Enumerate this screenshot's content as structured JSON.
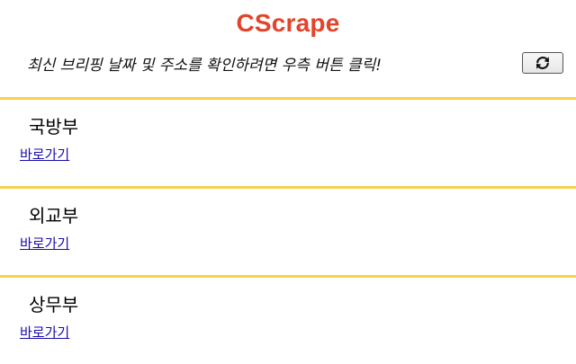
{
  "app": {
    "title": "CScrape",
    "instruction": "최신 브리핑 날짜 및 주소를 확인하려면 우측 버튼 클릭!",
    "refresh_icon": "refresh-icon"
  },
  "sections": [
    {
      "title": "국방부",
      "link_label": "바로가기"
    },
    {
      "title": "외교부",
      "link_label": "바로가기"
    },
    {
      "title": "상무부",
      "link_label": "바로가기"
    }
  ],
  "colors": {
    "title": "#e2432b",
    "divider": "#f5d24a",
    "link": "#1a0dab"
  }
}
